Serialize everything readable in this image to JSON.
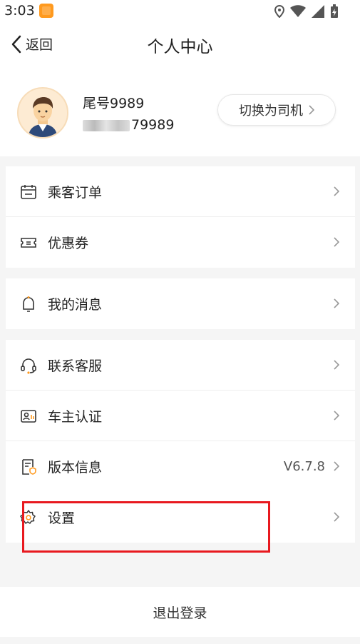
{
  "status_bar": {
    "time": "3:03"
  },
  "header": {
    "back_label": "返回",
    "title": "个人中心"
  },
  "profile": {
    "nickname": "尾号9989",
    "phone_visible": "79989",
    "switch_label": "切换为司机"
  },
  "menu_groups": [
    [
      {
        "label": "乘客订单",
        "icon": "calendar-icon"
      },
      {
        "label": "优惠券",
        "icon": "ticket-icon"
      }
    ],
    [
      {
        "label": "我的消息",
        "icon": "bell-icon"
      }
    ],
    [
      {
        "label": "联系客服",
        "icon": "headset-icon"
      },
      {
        "label": "车主认证",
        "icon": "id-card-icon"
      },
      {
        "label": "版本信息",
        "icon": "version-icon",
        "value": "V6.7.8"
      },
      {
        "label": "设置",
        "icon": "gear-icon"
      }
    ]
  ],
  "logout_label": "退出登录",
  "colors": {
    "accent": "#ff9a1f",
    "highlight": "#e8191f"
  }
}
